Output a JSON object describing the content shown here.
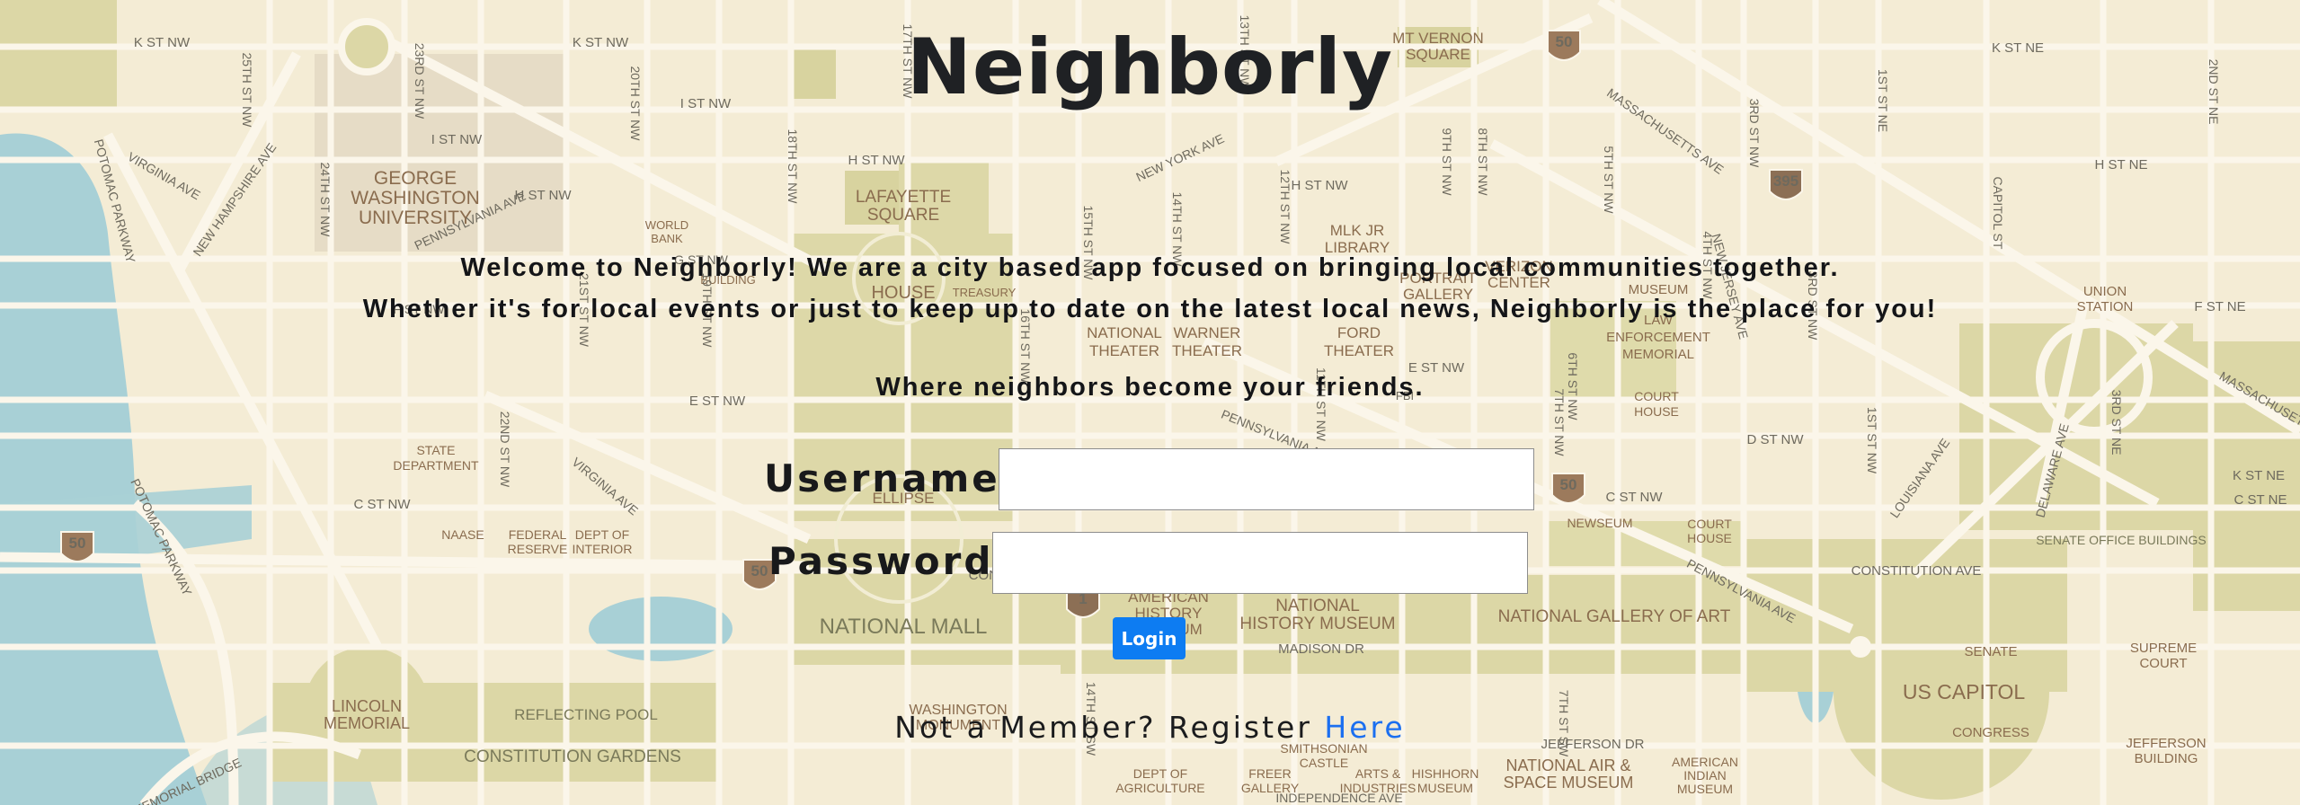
{
  "app": {
    "title": "Neighborly"
  },
  "intro": {
    "line1": "Welcome to Neighborly! We are a city based app focused on bringing local communities together.",
    "line2": "Whether it's for local events or just to keep up to date on the latest local news, Neighborly is the place for you!",
    "tagline": "Where neighbors become your friends."
  },
  "login_form": {
    "username_label": "Username:",
    "username_value": "",
    "password_label": "Password:",
    "password_value": "",
    "login_button": "Login"
  },
  "register": {
    "prefix": "Not a Member? Register ",
    "link_text": "Here"
  },
  "colors": {
    "accent": "#0d7cf2",
    "link": "#1b6ff0",
    "map_background": "#f3ecd6",
    "map_water": "#a7d0d6",
    "map_park": "#dfdbab"
  },
  "map": {
    "labels": [
      "K ST NW",
      "K ST NW",
      "K ST NE",
      "K ST NE",
      "I ST NW",
      "I ST NW",
      "H ST NW",
      "H ST NW",
      "H ST NW",
      "H ST NE",
      "G ST NW",
      "F ST NW",
      "F ST NE",
      "E ST NW",
      "E ST NW",
      "D ST NW",
      "C ST NW",
      "C ST NW",
      "C ST NE",
      "GEORGE",
      "WASHINGTON",
      "UNIVERSITY",
      "WORLD",
      "BANK",
      "LAFAYETTE",
      "SQUARE",
      "MT VERNON",
      "SQUARE",
      "MLK JR",
      "LIBRARY",
      "NATIONAL",
      "THEATER",
      "WARNER",
      "THEATER",
      "FORD",
      "THEATER",
      "VERIZON",
      "CENTER",
      "PORTRAIT",
      "GALLERY",
      "LAW",
      "ENFORCEMENT",
      "MEMORIAL",
      "MUSEUM",
      "COURT",
      "HOUSE",
      "COURT",
      "HOUSE",
      "UNION",
      "STATION",
      "STATE",
      "DEPARTMENT",
      "NAASE",
      "FEDERAL",
      "RESERVE",
      "DEPT OF",
      "INTERIOR",
      "ELLIPSE",
      "TREASURY",
      "HOUSE",
      "BUILDING",
      "NATIONAL MALL",
      "NATIONAL",
      "HISTORY MUSEUM",
      "AMERICAN",
      "HISTORY",
      "MUSEUM",
      "NATIONAL GALLERY OF ART",
      "NEWSEUM",
      "SENATE OFFICE BUILDINGS",
      "SENATE",
      "SUPREME",
      "COURT",
      "US CAPITOL",
      "CONGRESS",
      "JEFFERSON",
      "BUILDING",
      "LINCOLN",
      "MEMORIAL",
      "REFLECTING POOL",
      "CONSTITUTION GARDENS",
      "WASHINGTON",
      "MONUMENT",
      "DEPT OF",
      "AGRICULTURE",
      "FREER",
      "GALLERY",
      "SMITHSONIAN",
      "CASTLE",
      "ARTS &",
      "INDUSTRIES",
      "HISHHORN",
      "MUSEUM",
      "NATIONAL AIR &",
      "SPACE MUSEUM",
      "AMERICAN",
      "INDIAN",
      "MUSEUM",
      "JEFFERSON DR",
      "MADISON DR",
      "CONSTITUTION AVE",
      "CONSTITUTION AVE",
      "PENNSYLVANIA AVE",
      "PENNSYLVANIA AVE",
      "PENNSYLVANIA AVE",
      "NEW YORK AVE",
      "MASSACHUSETTS AVE",
      "MASSACHUSETTS AVE",
      "VIRGINIA AVE",
      "VIRGINIA AVE",
      "NEW HAMPSHIRE AVE",
      "POTOMAC PARKWAY",
      "POTOMAC PARKWAY",
      "LOUISIANA AVE",
      "DELAWARE AVE",
      "NEW JERSEY AVE",
      "MEMORIAL BRIDGE",
      "INDEPENDENCE AVE",
      "25TH ST NW",
      "24TH ST NW",
      "23RD ST NW",
      "22ND ST NW",
      "21ST ST NW",
      "20TH ST NW",
      "19TH ST NW",
      "18TH ST NW",
      "17TH ST NW",
      "16TH ST NW",
      "15TH ST NW",
      "14TH ST NW",
      "13TH ST NW",
      "12TH ST NW",
      "11TH ST NW",
      "9TH ST NW",
      "8TH ST NW",
      "7TH ST NW",
      "6TH ST NW",
      "5TH ST NW",
      "4TH ST NW",
      "3RD ST NW",
      "1ST ST NW",
      "1ST ST NE",
      "2ND ST NE",
      "3RD ST NE",
      "CAPITOL ST",
      "3RD ST NW",
      "7TH ST SW",
      "14TH ST SW",
      "FBI",
      "DEPT OF",
      "50",
      "50",
      "50",
      "50",
      "395",
      "1"
    ]
  }
}
